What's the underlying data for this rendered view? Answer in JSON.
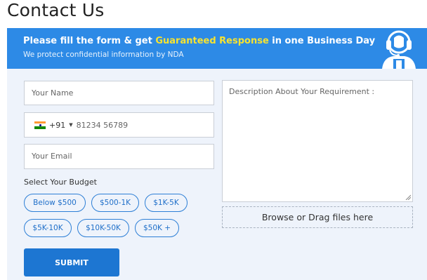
{
  "page": {
    "title": "Contact Us"
  },
  "banner": {
    "line1_prefix": "Please fill the form & get ",
    "line1_highlight": "Guaranteed Response",
    "line1_suffix": " in one Business Day",
    "line2": "We protect confidential information by NDA",
    "icon": "headset-support-icon",
    "background_color": "#2d8ae6",
    "highlight_color": "#f7e330"
  },
  "form": {
    "name_placeholder": "Your Name",
    "phone": {
      "country_flag": "india-flag-icon",
      "dial_code": "+91",
      "placeholder": "81234 56789"
    },
    "email_placeholder": "Your Email",
    "description_placeholder": "Description About Your Requirement :",
    "budget_label": "Select Your Budget",
    "budget_options": [
      "Below $500",
      "$500-1K",
      "$1K-5K",
      "$5K-10K",
      "$10K-50K",
      "$50K +"
    ],
    "upload_label": "Browse or Drag files here",
    "submit_label": "SUBMIT",
    "accent_color": "#1d76d2"
  }
}
